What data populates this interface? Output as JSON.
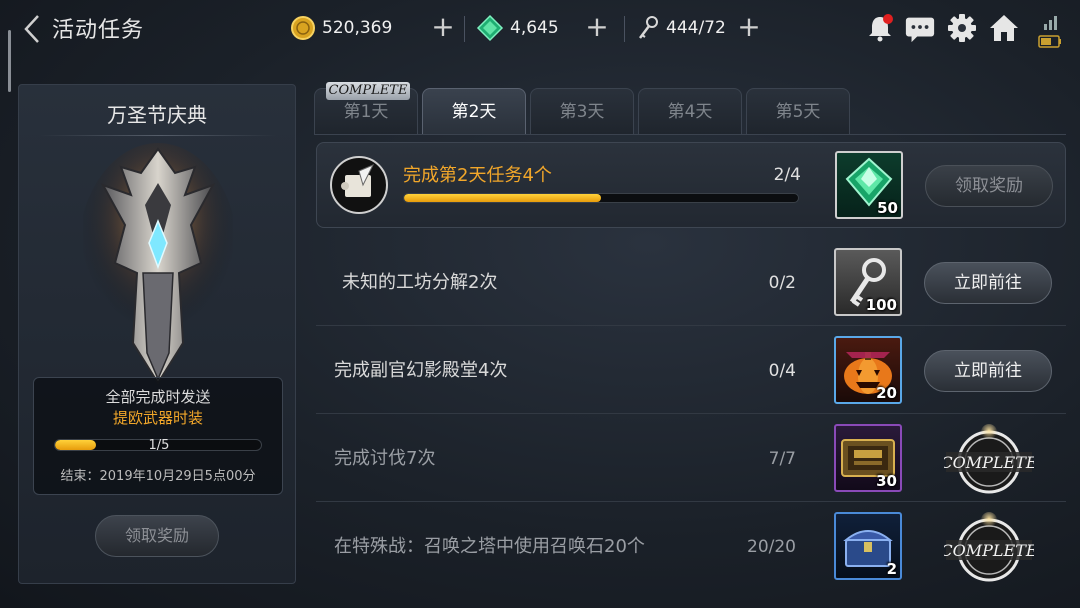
{
  "header": {
    "title": "活动任务",
    "gold": "520,369",
    "gems": "4,645",
    "keys": "444/72"
  },
  "event": {
    "name": "万圣节庆典",
    "reward_line1": "全部完成时发送",
    "reward_line2": "提欧武器时装",
    "progress_text": "1/5",
    "progress_fraction": 0.2,
    "end_time": "结束：2019年10月29日5点00分",
    "claim_label": "领取奖励"
  },
  "tabs": [
    {
      "label": "第1天",
      "badge": "COMPLETE"
    },
    {
      "label": "第2天"
    },
    {
      "label": "第3天"
    },
    {
      "label": "第4天"
    },
    {
      "label": "第5天"
    }
  ],
  "active_tab": 1,
  "tasks": [
    {
      "name": "完成第2天任务4个",
      "progress": "2/4",
      "progress_fraction": 0.5,
      "reward_qty": "50",
      "reward_icon": "green-gem-icon",
      "action": "领取奖励",
      "state": "claim-disabled"
    },
    {
      "name": "未知的工坊分解2次",
      "progress": "0/2",
      "reward_qty": "100",
      "reward_icon": "key-icon",
      "action": "立即前往",
      "state": "go"
    },
    {
      "name": "完成副官幻影殿堂4次",
      "progress": "0/4",
      "reward_qty": "20",
      "reward_icon": "pumpkin-icon",
      "action": "立即前往",
      "state": "go"
    },
    {
      "name": "完成讨伐7次",
      "progress": "7/7",
      "reward_qty": "30",
      "reward_icon": "nova-stone-icon",
      "action": "COMPLETE",
      "state": "complete"
    },
    {
      "name": "在特殊战：召唤之塔中使用召唤石20个",
      "progress": "20/20",
      "reward_qty": "2",
      "reward_icon": "chest-icon",
      "action": "COMPLETE",
      "state": "complete"
    }
  ],
  "colors": {
    "accent_gold": "#f2a72a",
    "progress_fill": "#f5b81c",
    "notification_dot": "#e02020"
  }
}
